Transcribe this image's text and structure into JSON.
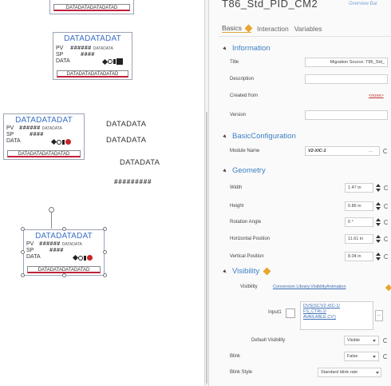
{
  "canvas": {
    "faceplates": [
      {
        "title": "DATADATADAT",
        "pv_label": "PV",
        "pv_value": "######",
        "pv_unit": "DATADATA",
        "sp_label": "SP",
        "sp_value": "####",
        "data_label": "DATA",
        "bottom": "DATADATADATADATAD"
      },
      {
        "title": "DATADATADAT",
        "pv_label": "PV",
        "pv_value": "######",
        "pv_unit": "DATADATA",
        "sp_label": "SP",
        "sp_value": "####",
        "data_label": "DATA",
        "bottom": "DATADATADATADATAD"
      },
      {
        "title": "DATADATADAT",
        "pv_label": "PV",
        "pv_value": "######",
        "pv_unit": "DATADATA",
        "sp_label": "SP",
        "sp_value": "####",
        "data_label": "DATA",
        "bottom": "DATADATADATADATAD"
      }
    ],
    "top_partial_bottom": "DATADATADATADATAD",
    "texts": {
      "t1": "DATADATA",
      "t2": "DATADATA",
      "t3": "DATADATA",
      "t4": "#########"
    }
  },
  "props": {
    "title": "T86_Std_PID_CM2",
    "subtitle": "Overview Bar",
    "tabs": [
      {
        "label": "Basics"
      },
      {
        "label": "Interaction"
      },
      {
        "label": "Variables"
      }
    ],
    "sections": {
      "information": "Information",
      "basic": "BasicConfiguration",
      "geometry": "Geometry",
      "visibility": "Visibility"
    },
    "information": {
      "title_label": "Title",
      "title_value": "Migration Source: T86_Std_",
      "description_label": "Description",
      "created_label": "Created from",
      "created_value": "<none>",
      "version_label": "Version"
    },
    "basic": {
      "module_label": "Module Name",
      "module_value": "V2-XIC-1"
    },
    "geometry": {
      "width_label": "Width",
      "width_value": "1.47 in",
      "height_label": "Height",
      "height_value": "0.86 in",
      "rotation_label": "Rotation Angle",
      "rotation_value": "0 °",
      "hpos_label": "Horizontal Position",
      "hpos_value": "11.61 in",
      "vpos_label": "Vertical Position",
      "vpos_value": "8.04 in"
    },
    "visibility": {
      "vis_label": "Visibility",
      "vis_value": "Conversion Library.VisibilityAnimation",
      "input_label": "Input1",
      "input_lines": [
        "DVS(SC'V2-XIC-1/",
        "FS_CTRL1/",
        "AVAILABLE.CV')"
      ],
      "default_label": "Default Visibility",
      "default_value": "Visible",
      "blink_label": "Blink",
      "blink_value": "False",
      "blinkstyle_label": "Blink Style",
      "blinkstyle_value": "Standard blink rate"
    }
  }
}
